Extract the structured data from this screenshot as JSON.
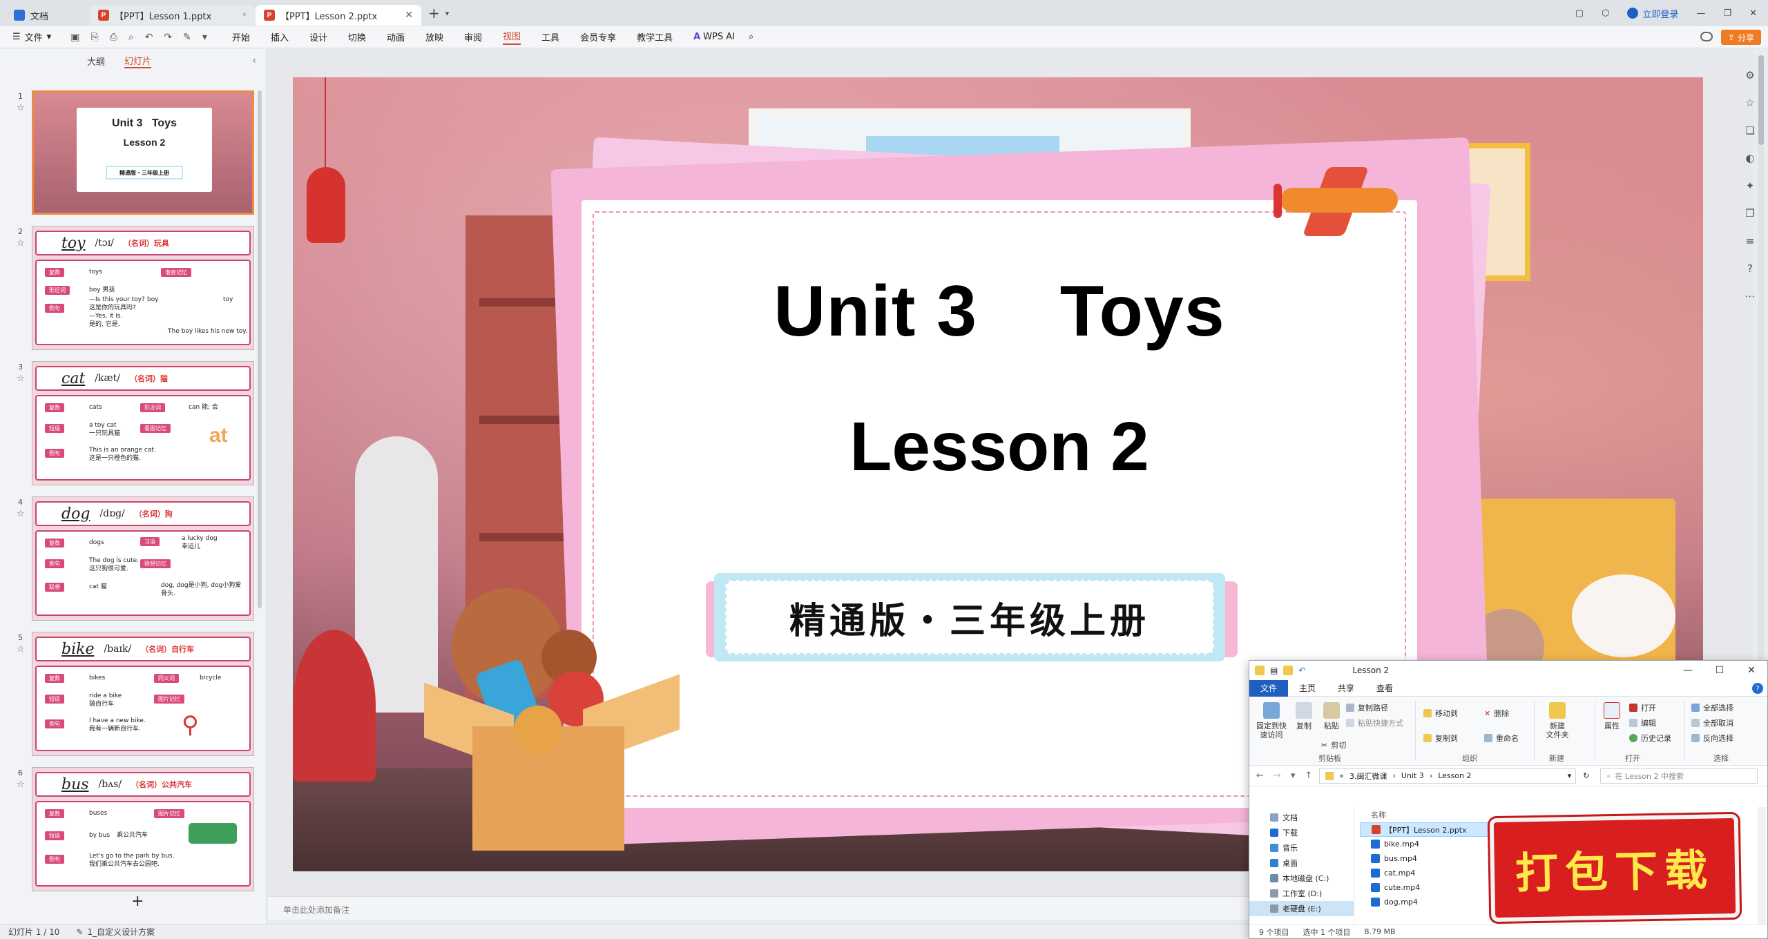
{
  "tabbar": {
    "tabs": [
      {
        "label": "文档"
      },
      {
        "label": "【PPT】Lesson 1.pptx"
      },
      {
        "label": "【PPT】Lesson 2.pptx"
      }
    ],
    "login": "立即登录"
  },
  "menubar": {
    "file": "文件",
    "items": [
      "开始",
      "插入",
      "设计",
      "切换",
      "动画",
      "放映",
      "审阅",
      "视图",
      "工具",
      "会员专享",
      "教学工具"
    ],
    "active": "视图",
    "wps_ai": "WPS AI",
    "share": "分享"
  },
  "leftpanel": {
    "tabs": [
      "大纲",
      "幻灯片"
    ],
    "active_tab": "幻灯片",
    "slides": [
      {
        "num": "1",
        "title": "Unit 3   Toys",
        "subtitle": "Lesson 2",
        "tag": "精通版・三年级上册"
      },
      {
        "num": "2",
        "word": "toy",
        "phon": "/tɔɪ/",
        "pos": "（名词）玩具",
        "lines": [
          "复数",
          "toys",
          "谐音记忆",
          "形近词",
          "boy 男孩",
          "例句",
          "—Is this your toy?",
          "这是你的玩具吗?",
          "—Yes, it is.",
          "是的, 它是.",
          "boy",
          "toy",
          "The boy likes his new toy."
        ]
      },
      {
        "num": "3",
        "word": "cat",
        "phon": "/kæt/",
        "pos": "（名词）猫",
        "lines": [
          "复数",
          "cats",
          "形近词",
          "can 能; 会",
          "短语",
          "a toy cat",
          "一只玩具猫",
          "看图记忆",
          "例句",
          "This is an orange cat.",
          "这是一只橙色的猫.",
          "at"
        ]
      },
      {
        "num": "4",
        "word": "dog",
        "phon": "/dɒg/",
        "pos": "（名词）狗",
        "lines": [
          "复数",
          "dogs",
          "习语",
          "a lucky dog",
          "幸运儿",
          "例句",
          "The dog is cute.",
          "这只狗很可爱.",
          "联想记忆",
          "联想",
          "cat 猫",
          "dog, dog是小狗, dog小狗爱骨头."
        ]
      },
      {
        "num": "5",
        "word": "bike",
        "phon": "/baɪk/",
        "pos": "（名词）自行车",
        "lines": [
          "复数",
          "bikes",
          "同义词",
          "bicycle",
          "短语",
          "ride a bike",
          "骑自行车",
          "图片记忆",
          "例句",
          "I have a new bike.",
          "我有一辆新自行车."
        ]
      },
      {
        "num": "6",
        "word": "bus",
        "phon": "/bʌs/",
        "pos": "（名词）公共汽车",
        "lines": [
          "复数",
          "buses",
          "图片记忆",
          "短语",
          "by bus",
          "乘公共汽车",
          "例句",
          "Let's go to the park by bus.",
          "我们乘公共汽车去公园吧."
        ]
      }
    ],
    "add": "+"
  },
  "slide": {
    "title_line1": "Unit 3    Toys",
    "title_line2": "Lesson 2",
    "subtitle": "精通版・三年级上册"
  },
  "notes_placeholder": "单击此处添加备注",
  "statusbar": {
    "slide_info": "幻灯片 1 / 10",
    "scheme": "1_自定义设计方案"
  },
  "explorer": {
    "title": "Lesson 2",
    "tabs": [
      "文件",
      "主页",
      "共享",
      "查看"
    ],
    "ribbon": {
      "pin": "固定到快\n速访问",
      "copy": "复制",
      "paste": "粘贴",
      "copy_path": "复制路径",
      "paste_shortcut": "粘贴快捷方式",
      "cut": "剪切",
      "group_clipboard": "剪贴板",
      "move_to": "移动到",
      "copy_to": "复制到",
      "delete": "删除",
      "rename": "重命名",
      "group_organize": "组织",
      "new_folder": "新建\n文件夹",
      "group_new": "新建",
      "properties": "属性",
      "open": "打开",
      "edit": "编辑",
      "history": "历史记录",
      "group_open": "打开",
      "select_all": "全部选择",
      "select_none": "全部取消",
      "invert": "反向选择",
      "group_select": "选择"
    },
    "path": [
      "3.闽汇微课",
      "Unit 3",
      "Lesson 2"
    ],
    "search_placeholder": "在 Lesson 2 中搜索",
    "nav": [
      "文档",
      "下载",
      "音乐",
      "桌面",
      "本地磁盘 (C:)",
      "工作室 (D:)",
      "老硬盘 (E:)"
    ],
    "nav_selected": "老硬盘 (E:)",
    "column_name": "名称",
    "files": [
      "【PPT】Lesson 2.pptx",
      "bike.mp4",
      "bus.mp4",
      "cat.mp4",
      "cute.mp4",
      "dog.mp4"
    ],
    "status_items": "9 个项目",
    "status_selected": "选中 1 个项目",
    "status_size": "8.79 MB"
  },
  "download_banner": "打包下载"
}
